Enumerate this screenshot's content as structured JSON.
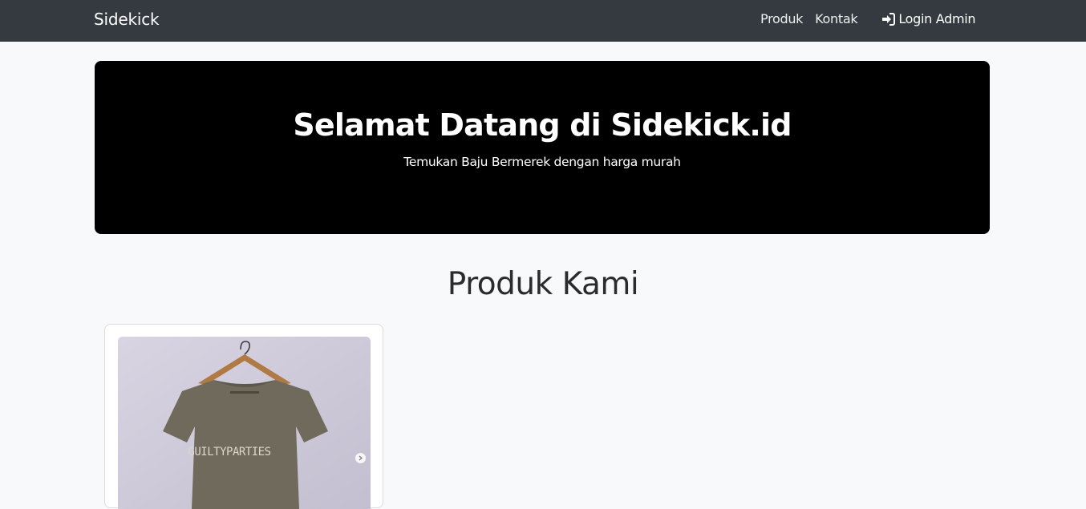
{
  "navbar": {
    "brand": "Sidekick",
    "links": [
      {
        "label": "Produk"
      },
      {
        "label": "Kontak"
      }
    ],
    "login": {
      "label": "Login Admin",
      "icon": "sign-in-icon"
    }
  },
  "hero": {
    "title": "Selamat Datang di Sidekick.id",
    "subtitle": "Temukan Baju Bermerek dengan harga murah"
  },
  "products": {
    "heading": "Produk Kami",
    "items": [
      {
        "image_text": "GUILTYPARTIES",
        "shirt_color": "#6f6a5c"
      }
    ]
  },
  "colors": {
    "navbar_bg": "#343a40",
    "hero_bg": "#000000",
    "page_bg": "#f8f9fa"
  }
}
